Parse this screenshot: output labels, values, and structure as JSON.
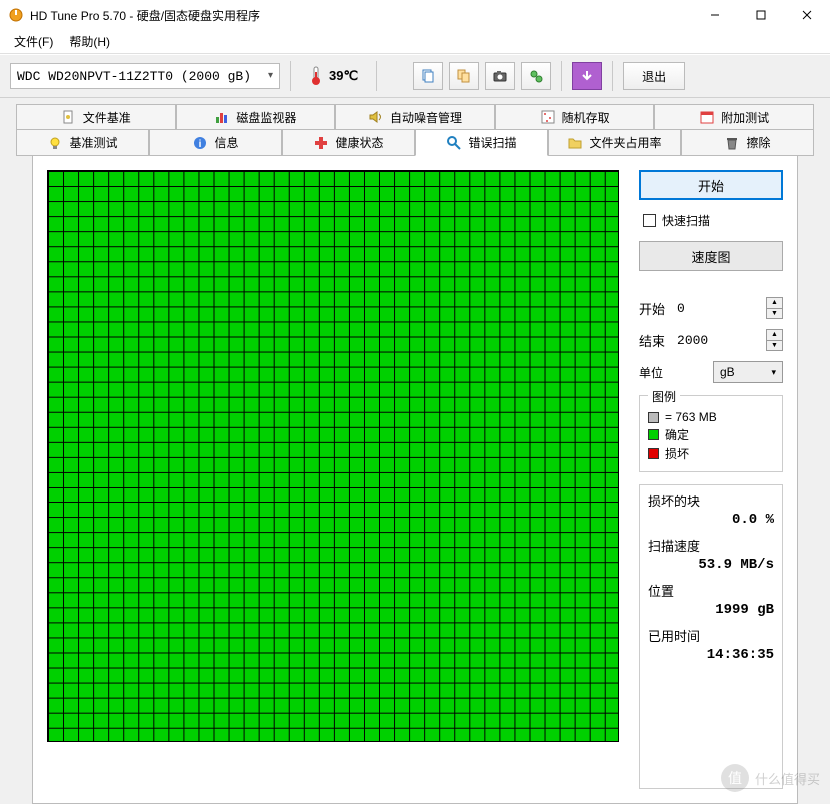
{
  "window": {
    "title": "HD Tune Pro 5.70 - 硬盘/固态硬盘实用程序"
  },
  "menu": {
    "file": "文件(F)",
    "help": "帮助(H)"
  },
  "toolbar": {
    "drive": "WDC WD20NPVT-11Z2TT0 (2000 gB)",
    "temp": "39℃",
    "exit": "退出"
  },
  "tabs": {
    "row1": [
      {
        "label": "文件基准",
        "icon": "file-benchmark"
      },
      {
        "label": "磁盘监视器",
        "icon": "disk-monitor"
      },
      {
        "label": "自动噪音管理",
        "icon": "noise"
      },
      {
        "label": "随机存取",
        "icon": "random-access"
      },
      {
        "label": "附加测试",
        "icon": "extra-test"
      }
    ],
    "row2": [
      {
        "label": "基准测试",
        "icon": "benchmark"
      },
      {
        "label": "信息",
        "icon": "info"
      },
      {
        "label": "健康状态",
        "icon": "health"
      },
      {
        "label": "错误扫描",
        "icon": "error-scan",
        "active": true
      },
      {
        "label": "文件夹占用率",
        "icon": "folder-usage"
      },
      {
        "label": "擦除",
        "icon": "erase"
      }
    ]
  },
  "scan": {
    "start_btn": "开始",
    "quick_scan": "快速扫描",
    "speed_map_btn": "速度图",
    "start_label": "开始",
    "start_val": "0",
    "end_label": "结束",
    "end_val": "2000",
    "unit_label": "单位",
    "unit_val": "gB",
    "legend_title": "图例",
    "legend_block": "= 763 MB",
    "legend_ok": "确定",
    "legend_bad": "损坏",
    "stats": {
      "damaged_label": "损坏的块",
      "damaged_val": "0.0 %",
      "speed_label": "扫描速度",
      "speed_val": "53.9 MB/s",
      "pos_label": "位置",
      "pos_val": "1999 gB",
      "time_label": "已用时间",
      "time_val": "14:36:35"
    }
  },
  "watermark": "什么值得买"
}
